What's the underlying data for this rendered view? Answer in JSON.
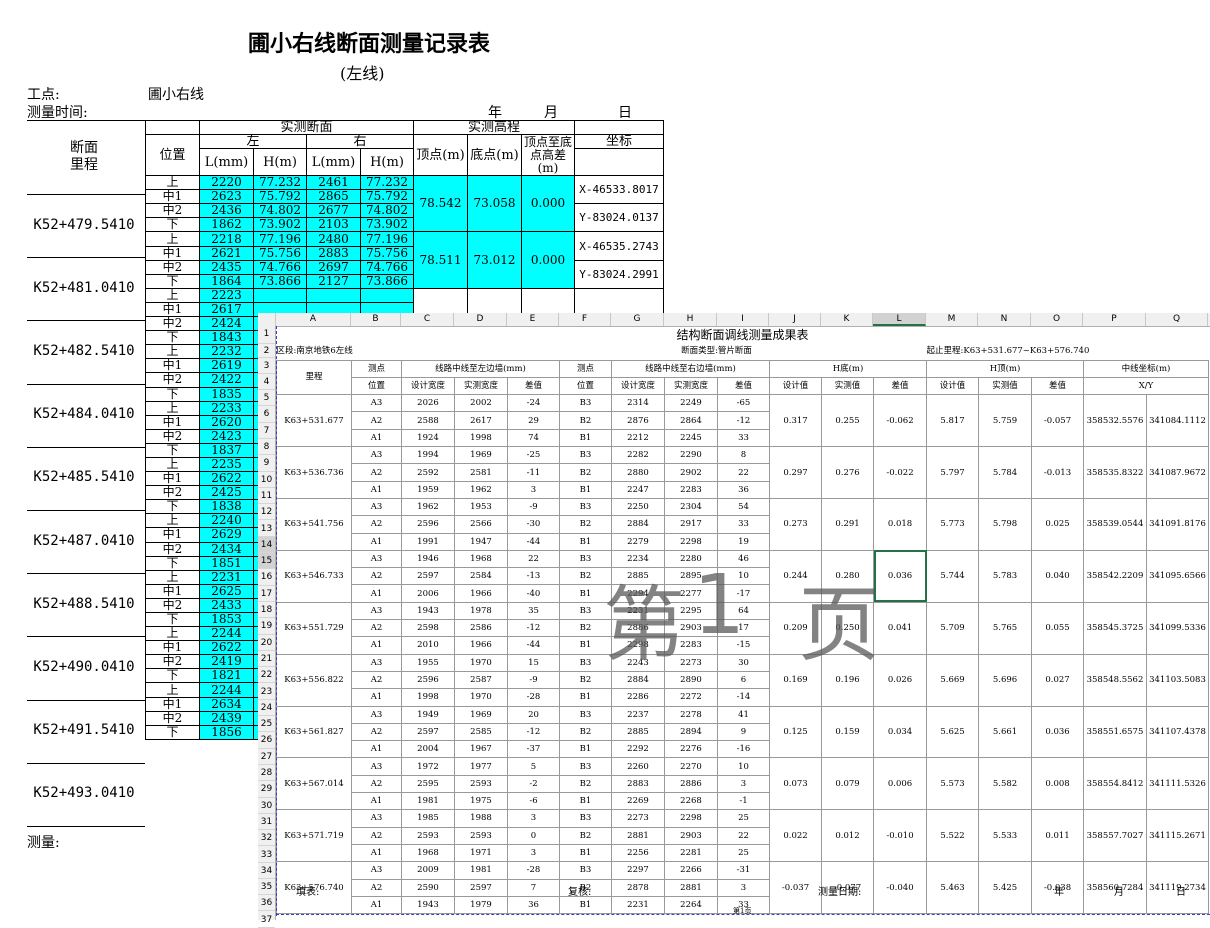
{
  "left_doc": {
    "title": "圃小右线断面测量记录表",
    "subtitle": "(左线)",
    "site_label": "工点:",
    "site_value": "圃小右线",
    "time_label": "测量时间:",
    "year": "年",
    "month": "月",
    "day": "日",
    "h_section": "断面\n里程",
    "h_measured": "实测断面",
    "h_left": "左",
    "h_right": "右",
    "h_pos": "位置",
    "h_l": "L(mm)",
    "h_h": "H(m)",
    "h_elev": "实测高程",
    "h_top": "顶点(m)",
    "h_bottom": "底点(m)",
    "h_diff": "顶点至底点高差(m)",
    "h_coord": "坐标",
    "footer": "测量:",
    "sections": [
      {
        "mileage": "K52+479.5410",
        "top": "78.542",
        "bottom": "73.058",
        "diff": "0.000",
        "x": "X-46533.8017",
        "y": "Y-83024.0137",
        "rows": [
          [
            "上",
            "2220",
            "77.232",
            "2461",
            "77.232"
          ],
          [
            "中1",
            "2623",
            "75.792",
            "2865",
            "75.792"
          ],
          [
            "中2",
            "2436",
            "74.802",
            "2677",
            "74.802"
          ],
          [
            "下",
            "1862",
            "73.902",
            "2103",
            "73.902"
          ]
        ]
      },
      {
        "mileage": "K52+481.0410",
        "top": "78.511",
        "bottom": "73.012",
        "diff": "0.000",
        "x": "X-46535.2743",
        "y": "Y-83024.2991",
        "rows": [
          [
            "上",
            "2218",
            "77.196",
            "2480",
            "77.196"
          ],
          [
            "中1",
            "2621",
            "75.756",
            "2883",
            "75.756"
          ],
          [
            "中2",
            "2435",
            "74.766",
            "2697",
            "74.766"
          ],
          [
            "下",
            "1864",
            "73.866",
            "2127",
            "73.866"
          ]
        ]
      },
      {
        "mileage": "K52+482.5410",
        "rows": [
          [
            "上",
            "2223"
          ],
          [
            "中1",
            "2617"
          ],
          [
            "中2",
            "2424"
          ],
          [
            "下",
            "1843"
          ]
        ]
      },
      {
        "mileage": "K52+484.0410",
        "rows": [
          [
            "上",
            "2232"
          ],
          [
            "中1",
            "2619"
          ],
          [
            "中2",
            "2422"
          ],
          [
            "下",
            "1835"
          ]
        ]
      },
      {
        "mileage": "K52+485.5410",
        "rows": [
          [
            "上",
            "2233"
          ],
          [
            "中1",
            "2620"
          ],
          [
            "中2",
            "2423"
          ],
          [
            "下",
            "1837"
          ]
        ]
      },
      {
        "mileage": "K52+487.0410",
        "rows": [
          [
            "上",
            "2235"
          ],
          [
            "中1",
            "2622"
          ],
          [
            "中2",
            "2425"
          ],
          [
            "下",
            "1838"
          ]
        ]
      },
      {
        "mileage": "K52+488.5410",
        "rows": [
          [
            "上",
            "2240"
          ],
          [
            "中1",
            "2629"
          ],
          [
            "中2",
            "2434"
          ],
          [
            "下",
            "1851"
          ]
        ]
      },
      {
        "mileage": "K52+490.0410",
        "rows": [
          [
            "上",
            "2231"
          ],
          [
            "中1",
            "2625"
          ],
          [
            "中2",
            "2433"
          ],
          [
            "下",
            "1853"
          ]
        ]
      },
      {
        "mileage": "K52+491.5410",
        "rows": [
          [
            "上",
            "2244"
          ],
          [
            "中1",
            "2622"
          ],
          [
            "中2",
            "2419"
          ],
          [
            "下",
            "1821"
          ]
        ]
      },
      {
        "mileage": "K52+493.0410",
        "rows": [
          [
            "上",
            "2244"
          ],
          [
            "中1",
            "2634"
          ],
          [
            "中2",
            "2439"
          ],
          [
            "下",
            "1856"
          ]
        ]
      }
    ]
  },
  "sheet": {
    "columns": [
      "A",
      "B",
      "C",
      "D",
      "E",
      "F",
      "G",
      "H",
      "I",
      "J",
      "K",
      "L",
      "M",
      "N",
      "O",
      "P",
      "Q"
    ],
    "row_numbers": [
      "1",
      "2",
      "3",
      "4",
      "5",
      "6",
      "7",
      "8",
      "9",
      "10",
      "11",
      "12",
      "13",
      "14",
      "15",
      "16",
      "17",
      "18",
      "19",
      "20",
      "21",
      "22",
      "23",
      "24",
      "25",
      "26",
      "27",
      "28",
      "29",
      "30",
      "31",
      "32",
      "33",
      "34",
      "35",
      "36",
      "37"
    ],
    "title": "结构断面调线测量成果表",
    "zone": "区段:南京地铁6左线",
    "type": "断面类型:管片断面",
    "range": "起止里程:K63+531.677~K63+576.740",
    "h_mileage": "里程",
    "h_pt": "测点",
    "h_pos": "位置",
    "h_left_wall": "线路中线至左边墙(mm)",
    "h_right_wall": "线路中线至右边墙(mm)",
    "h_design": "设计宽度",
    "h_measured": "实测宽度",
    "h_diff": "差值",
    "h_hbottom": "H底(m)",
    "h_htop": "H顶(m)",
    "h_dv": "设计值",
    "h_mv": "实测值",
    "h_coord": "中线坐标(m)",
    "h_xy": "X/Y",
    "groups": [
      {
        "mileage": "K63+531.677",
        "hb": [
          "0.317",
          "0.255",
          "-0.062"
        ],
        "ht": [
          "5.817",
          "5.759",
          "-0.057"
        ],
        "x": "358532.5576",
        "y": "341084.1112",
        "rows": [
          [
            "A3",
            "2026",
            "2002",
            "-24",
            "B3",
            "2314",
            "2249",
            "-65"
          ],
          [
            "A2",
            "2588",
            "2617",
            "29",
            "B2",
            "2876",
            "2864",
            "-12"
          ],
          [
            "A1",
            "1924",
            "1998",
            "74",
            "B1",
            "2212",
            "2245",
            "33"
          ]
        ]
      },
      {
        "mileage": "K63+536.736",
        "hb": [
          "0.297",
          "0.276",
          "-0.022"
        ],
        "ht": [
          "5.797",
          "5.784",
          "-0.013"
        ],
        "x": "358535.8322",
        "y": "341087.9672",
        "rows": [
          [
            "A3",
            "1994",
            "1969",
            "-25",
            "B3",
            "2282",
            "2290",
            "8"
          ],
          [
            "A2",
            "2592",
            "2581",
            "-11",
            "B2",
            "2880",
            "2902",
            "22"
          ],
          [
            "A1",
            "1959",
            "1962",
            "3",
            "B1",
            "2247",
            "2283",
            "36"
          ]
        ]
      },
      {
        "mileage": "K63+541.756",
        "hb": [
          "0.273",
          "0.291",
          "0.018"
        ],
        "ht": [
          "5.773",
          "5.798",
          "0.025"
        ],
        "x": "358539.0544",
        "y": "341091.8176",
        "rows": [
          [
            "A3",
            "1962",
            "1953",
            "-9",
            "B3",
            "2250",
            "2304",
            "54"
          ],
          [
            "A2",
            "2596",
            "2566",
            "-30",
            "B2",
            "2884",
            "2917",
            "33"
          ],
          [
            "A1",
            "1991",
            "1947",
            "-44",
            "B1",
            "2279",
            "2298",
            "19"
          ]
        ]
      },
      {
        "mileage": "K63+546.733",
        "hb": [
          "0.244",
          "0.280",
          "0.036"
        ],
        "ht": [
          "5.744",
          "5.783",
          "0.040"
        ],
        "x": "358542.2209",
        "y": "341095.6566",
        "rows": [
          [
            "A3",
            "1946",
            "1968",
            "22",
            "B3",
            "2234",
            "2280",
            "46"
          ],
          [
            "A2",
            "2597",
            "2584",
            "-13",
            "B2",
            "2885",
            "2895",
            "10"
          ],
          [
            "A1",
            "2006",
            "1966",
            "-40",
            "B1",
            "2294",
            "2277",
            "-17"
          ]
        ]
      },
      {
        "mileage": "K63+551.729",
        "hb": [
          "0.209",
          "0.250",
          "0.041"
        ],
        "ht": [
          "5.709",
          "5.765",
          "0.055"
        ],
        "x": "358545.3725",
        "y": "341099.5336",
        "rows": [
          [
            "A3",
            "1943",
            "1978",
            "35",
            "B3",
            "2231",
            "2295",
            "64"
          ],
          [
            "A2",
            "2598",
            "2586",
            "-12",
            "B2",
            "2886",
            "2903",
            "17"
          ],
          [
            "A1",
            "2010",
            "1966",
            "-44",
            "B1",
            "2298",
            "2283",
            "-15"
          ]
        ]
      },
      {
        "mileage": "K63+556.822",
        "hb": [
          "0.169",
          "0.196",
          "0.026"
        ],
        "ht": [
          "5.669",
          "5.696",
          "0.027"
        ],
        "x": "358548.5562",
        "y": "341103.5083",
        "rows": [
          [
            "A3",
            "1955",
            "1970",
            "15",
            "B3",
            "2243",
            "2273",
            "30"
          ],
          [
            "A2",
            "2596",
            "2587",
            "-9",
            "B2",
            "2884",
            "2890",
            "6"
          ],
          [
            "A1",
            "1998",
            "1970",
            "-28",
            "B1",
            "2286",
            "2272",
            "-14"
          ]
        ]
      },
      {
        "mileage": "K63+561.827",
        "hb": [
          "0.125",
          "0.159",
          "0.034"
        ],
        "ht": [
          "5.625",
          "5.661",
          "0.036"
        ],
        "x": "358551.6575",
        "y": "341107.4378",
        "rows": [
          [
            "A3",
            "1949",
            "1969",
            "20",
            "B3",
            "2237",
            "2278",
            "41"
          ],
          [
            "A2",
            "2597",
            "2585",
            "-12",
            "B2",
            "2885",
            "2894",
            "9"
          ],
          [
            "A1",
            "2004",
            "1967",
            "-37",
            "B1",
            "2292",
            "2276",
            "-16"
          ]
        ]
      },
      {
        "mileage": "K63+567.014",
        "hb": [
          "0.073",
          "0.079",
          "0.006"
        ],
        "ht": [
          "5.573",
          "5.582",
          "0.008"
        ],
        "x": "358554.8412",
        "y": "341111.5326",
        "rows": [
          [
            "A3",
            "1972",
            "1977",
            "5",
            "B3",
            "2260",
            "2270",
            "10"
          ],
          [
            "A2",
            "2595",
            "2593",
            "-2",
            "B2",
            "2883",
            "2886",
            "3"
          ],
          [
            "A1",
            "1981",
            "1975",
            "-6",
            "B1",
            "2269",
            "2268",
            "-1"
          ]
        ]
      },
      {
        "mileage": "K63+571.719",
        "hb": [
          "0.022",
          "0.012",
          "-0.010"
        ],
        "ht": [
          "5.522",
          "5.533",
          "0.011"
        ],
        "x": "358557.7027",
        "y": "341115.2671",
        "rows": [
          [
            "A3",
            "1985",
            "1988",
            "3",
            "B3",
            "2273",
            "2298",
            "25"
          ],
          [
            "A2",
            "2593",
            "2593",
            "0",
            "B2",
            "2881",
            "2903",
            "22"
          ],
          [
            "A1",
            "1968",
            "1971",
            "3",
            "B1",
            "2256",
            "2281",
            "25"
          ]
        ]
      },
      {
        "mileage": "K63+576.740",
        "hb": [
          "-0.037",
          "-0.077",
          "-0.040"
        ],
        "ht": [
          "5.463",
          "5.425",
          "-0.038"
        ],
        "x": "358560.7284",
        "y": "341119.2734",
        "rows": [
          [
            "A3",
            "2009",
            "1981",
            "-28",
            "B3",
            "2297",
            "2266",
            "-31"
          ],
          [
            "A2",
            "2590",
            "2597",
            "7",
            "B2",
            "2878",
            "2881",
            "3"
          ],
          [
            "A1",
            "1943",
            "1979",
            "36",
            "B1",
            "2231",
            "2264",
            "33"
          ]
        ]
      }
    ],
    "f_fill": "填表:",
    "f_check": "复核:",
    "f_date": "测量日期:",
    "f_year": "年",
    "f_month": "月",
    "f_day": "日",
    "page_label": "第1页",
    "watermark": [
      "第",
      "1",
      "页"
    ]
  }
}
